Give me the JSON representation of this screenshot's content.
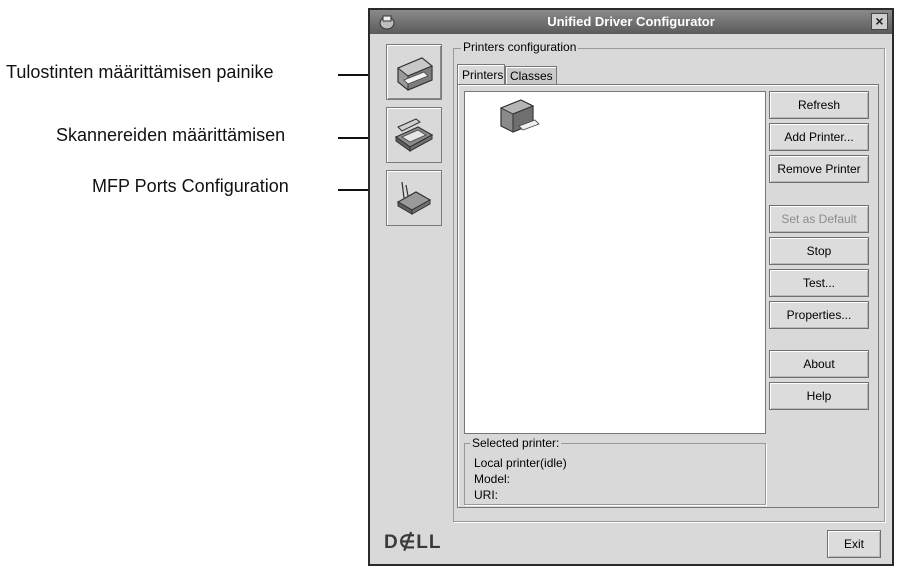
{
  "callouts": {
    "printers_button": "Tulostinten määrittämisen painike",
    "scanners_button": "Skannereiden määrittämisen",
    "mfp_ports": "MFP Ports Configuration"
  },
  "window": {
    "title": "Unified Driver Configurator",
    "close_glyph": "×",
    "sidebar": [
      {
        "name": "printers-config",
        "icon": "printer-icon"
      },
      {
        "name": "scanners-config",
        "icon": "scanner-icon"
      },
      {
        "name": "mfp-ports-config",
        "icon": "port-icon"
      }
    ],
    "group_title": "Printers configuration",
    "tabs": [
      "Printers",
      "Classes"
    ],
    "buttons": {
      "refresh": "Refresh",
      "add_printer": "Add Printer...",
      "remove_printer": "Remove Printer",
      "set_default": "Set as Default",
      "stop": "Stop",
      "test": "Test...",
      "properties": "Properties...",
      "about": "About",
      "help": "Help"
    },
    "selected": {
      "legend": "Selected printer:",
      "status": "Local printer(idle)",
      "model": "Model:",
      "uri": "URI:"
    },
    "logo": "D∉LL",
    "exit": "Exit"
  },
  "colors": {
    "window_bg": "#d9d9d9",
    "titlebar": "#6a6a6a",
    "list_bg": "#ffffff"
  }
}
